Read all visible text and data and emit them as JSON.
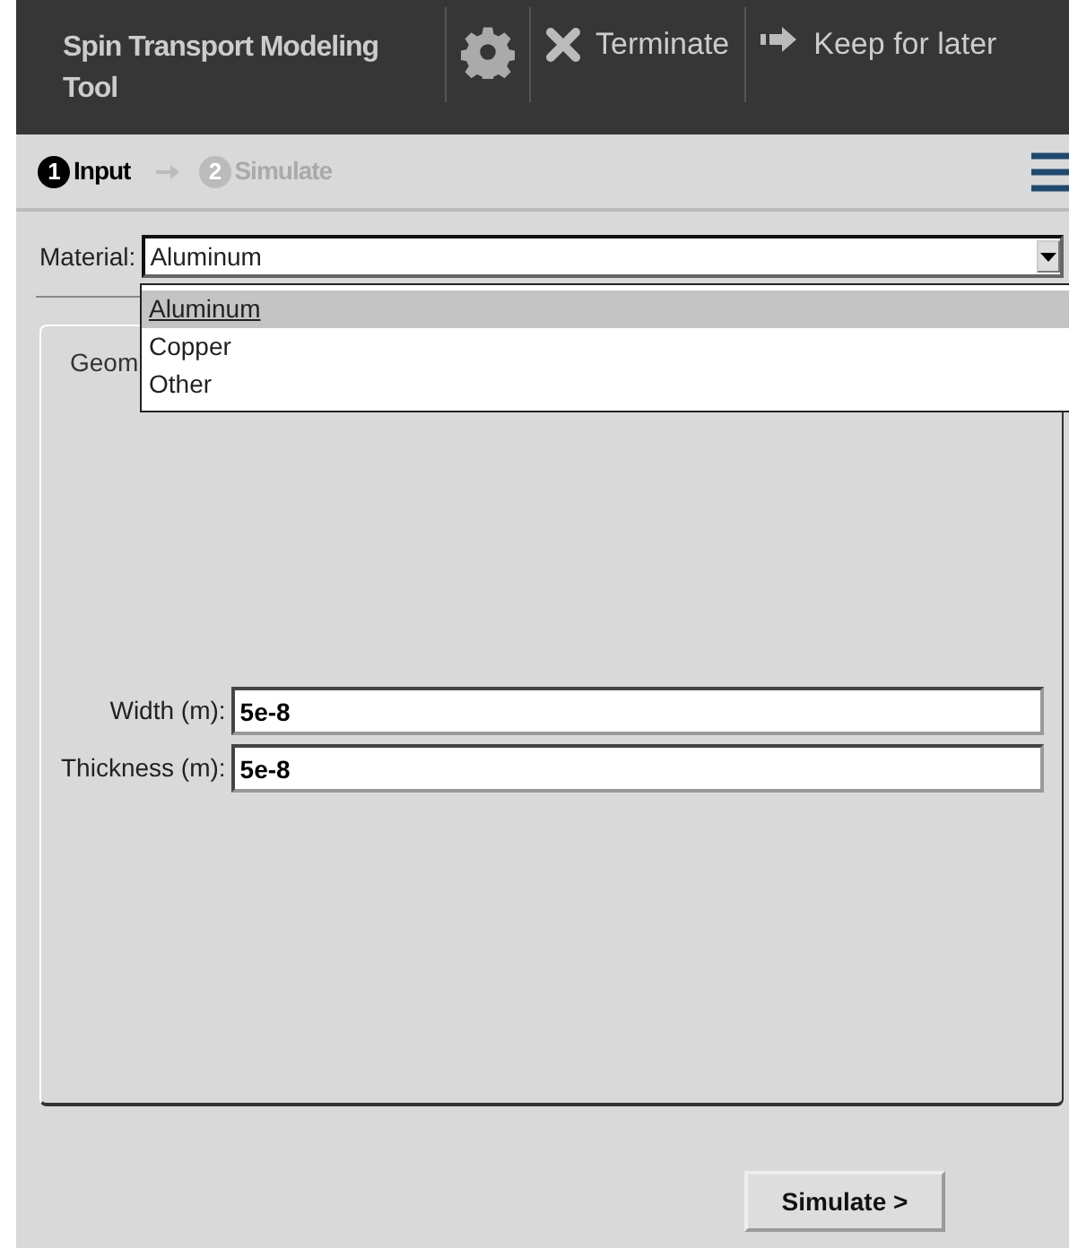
{
  "header": {
    "title": "Spin Transport Modeling Tool",
    "actions": [
      {
        "kind": "gear"
      },
      {
        "kind": "terminate",
        "label": "Terminate"
      },
      {
        "kind": "keep",
        "label": "Keep for later"
      }
    ]
  },
  "steps": [
    {
      "number": "1",
      "label": "Input",
      "selected": true
    },
    {
      "number": "2",
      "label": "Simulate",
      "selected": false
    }
  ],
  "material": {
    "label": "Material:",
    "value": "Aluminum",
    "expanded": true,
    "options": [
      {
        "label": "Aluminum",
        "selected": true
      },
      {
        "label": "Copper",
        "selected": false
      },
      {
        "label": "Other",
        "selected": false
      }
    ]
  },
  "tab": {
    "label": "Geom"
  },
  "fields": [
    {
      "label": "Width (m):",
      "value": "5e-8"
    },
    {
      "label": "Thickness (m):",
      "value": "5e-8"
    }
  ],
  "simulate_button": "Simulate >"
}
